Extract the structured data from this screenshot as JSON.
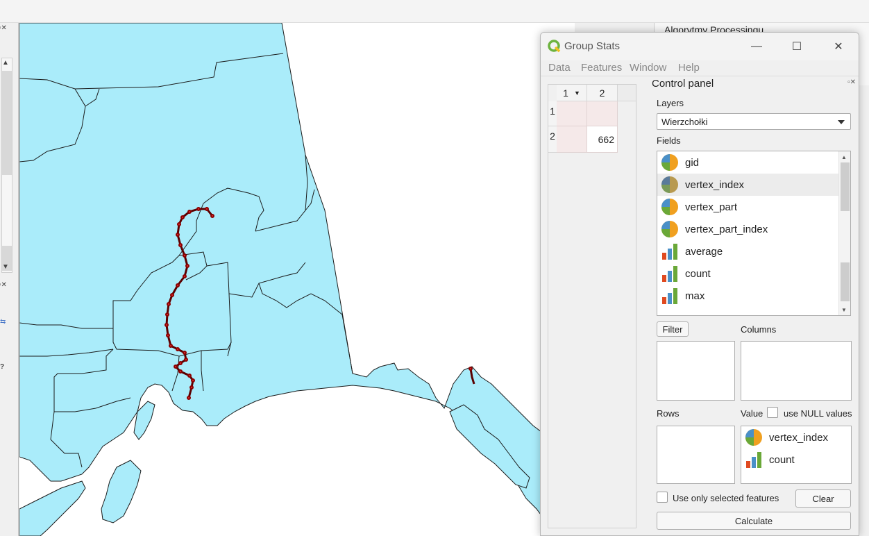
{
  "behind_panel": {
    "title": "Algorytmy Processingu"
  },
  "window": {
    "title": "Group Stats",
    "menu": [
      "Data",
      "Features",
      "Window",
      "Help"
    ],
    "controls": {
      "minimize": "—",
      "maximize": "☐",
      "close": "✕"
    }
  },
  "result_table": {
    "column_headers": [
      "1",
      "2"
    ],
    "rows": [
      {
        "header": "1",
        "cells": [
          "",
          ""
        ]
      },
      {
        "header": "2",
        "cells": [
          "",
          "662"
        ]
      }
    ]
  },
  "control_panel": {
    "title": "Control panel",
    "layers_label": "Layers",
    "layer_selected": "Wierzchołki",
    "fields_label": "Fields",
    "fields": [
      {
        "name": "gid",
        "icon": "pie-icon"
      },
      {
        "name": "vertex_index",
        "icon": "pie-icon"
      },
      {
        "name": "vertex_part",
        "icon": "pie-icon"
      },
      {
        "name": "vertex_part_index",
        "icon": "pie-icon"
      },
      {
        "name": "average",
        "icon": "bar-chart-icon"
      },
      {
        "name": "count",
        "icon": "bar-chart-icon"
      },
      {
        "name": "max",
        "icon": "bar-chart-icon"
      }
    ],
    "filter_label": "Filter",
    "columns_label": "Columns",
    "rows_label": "Rows",
    "value_label": "Value",
    "use_null_label": "use NULL values",
    "value_items": [
      {
        "name": "vertex_index",
        "icon": "pie-icon"
      },
      {
        "name": "count",
        "icon": "bar-chart-icon"
      }
    ],
    "use_selected_label": "Use only selected features",
    "clear_label": "Clear",
    "calculate_label": "Calculate"
  },
  "colors": {
    "map_land": "#aaecfa",
    "map_border": "#1a1a1a",
    "track": "#e03030",
    "accent_green": "#6db33f"
  }
}
